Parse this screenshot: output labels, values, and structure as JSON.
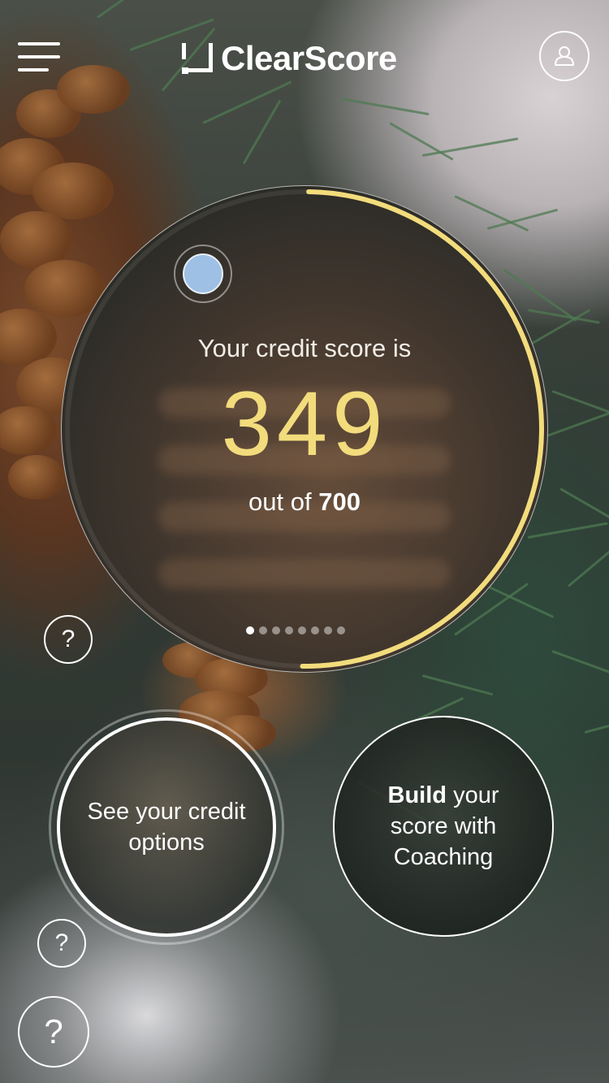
{
  "header": {
    "brand": "ClearScore",
    "menu_icon": "hamburger-menu-icon",
    "profile_icon": "user-profile-icon"
  },
  "score": {
    "label": "Your credit score is",
    "value": "349",
    "out_of_prefix": "out of",
    "out_of_max": "700",
    "progress_fraction": 0.4986,
    "pager_count": 8,
    "pager_active_index": 0
  },
  "actions": {
    "credit_options": "See your credit options",
    "coaching_bold": "Build",
    "coaching_rest": "your score with Coaching"
  },
  "help": {
    "symbol": "?"
  },
  "colors": {
    "accent_yellow": "#f2dc7c",
    "knob_blue": "#9ec0e4",
    "white": "#ffffff"
  }
}
